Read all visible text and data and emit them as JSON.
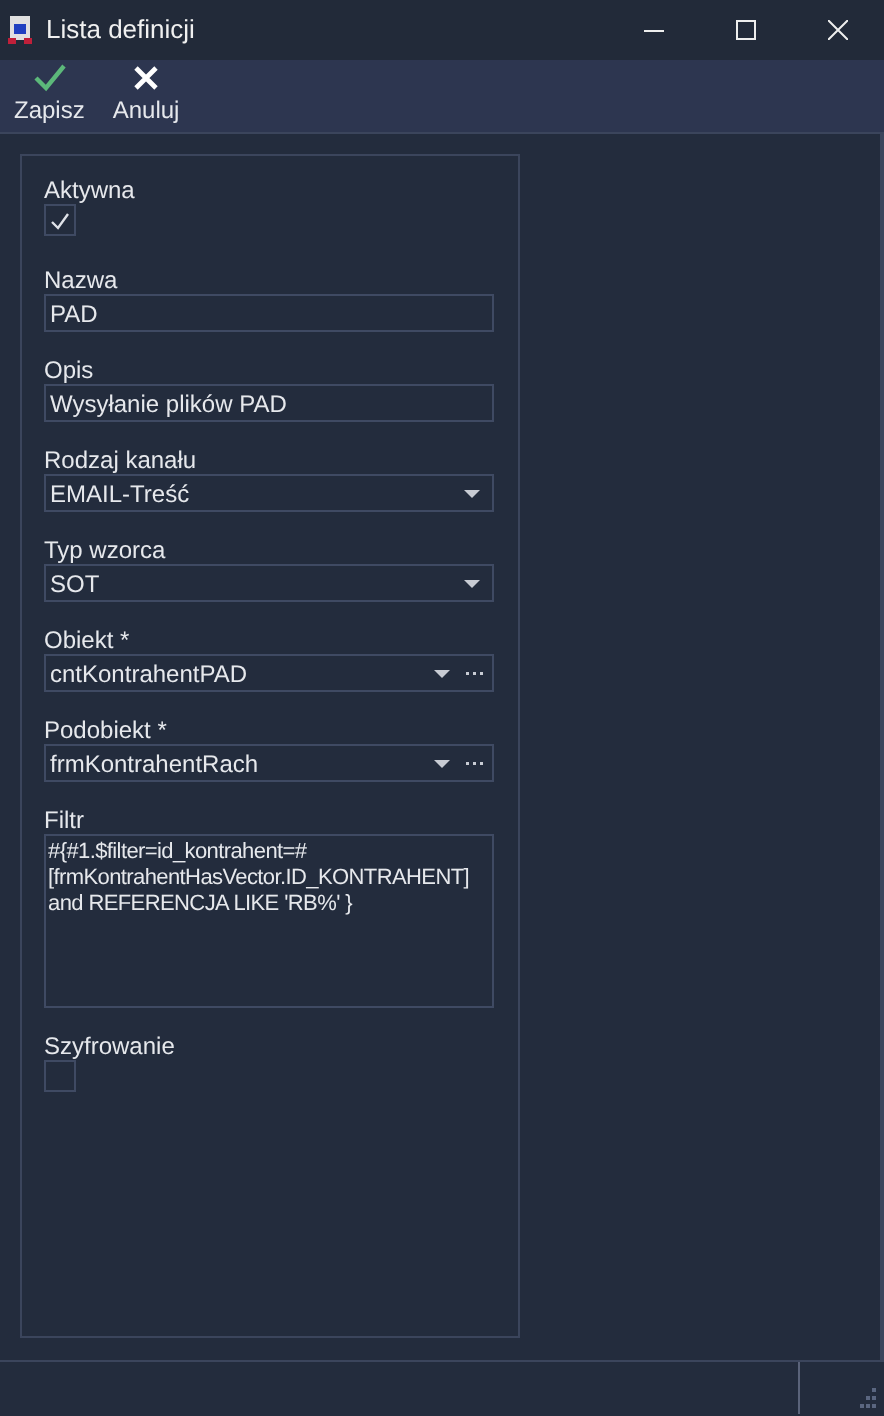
{
  "window": {
    "title": "Lista definicji"
  },
  "toolbar": [
    {
      "kind": "save",
      "label": "Zapisz"
    },
    {
      "kind": "cancel",
      "label": "Anuluj"
    }
  ],
  "fields": [
    {
      "kind": "checkbox",
      "label": "Aktywna",
      "checked": true
    },
    {
      "kind": "text",
      "label": "Nazwa",
      "value": "PAD"
    },
    {
      "kind": "text",
      "label": "Opis",
      "value": "Wysyłanie plików PAD"
    },
    {
      "kind": "combo",
      "label": "Rodzaj kanału",
      "value": "EMAIL-Treść"
    },
    {
      "kind": "combo",
      "label": "Typ wzorca",
      "value": "SOT"
    },
    {
      "kind": "lookup",
      "label": "Obiekt *",
      "value": "cntKontrahentPAD"
    },
    {
      "kind": "lookup",
      "label": "Podobiekt *",
      "value": "frmKontrahentRach"
    },
    {
      "kind": "textarea",
      "label": "Filtr",
      "value": "#{#1.$filter=id_kontrahent=#\n[frmKontrahentHasVector.ID_KONTRAHENT]\nand REFERENCJA LIKE 'RB%' }"
    },
    {
      "kind": "checkbox",
      "label": "Szyfrowanie",
      "checked": false
    }
  ]
}
